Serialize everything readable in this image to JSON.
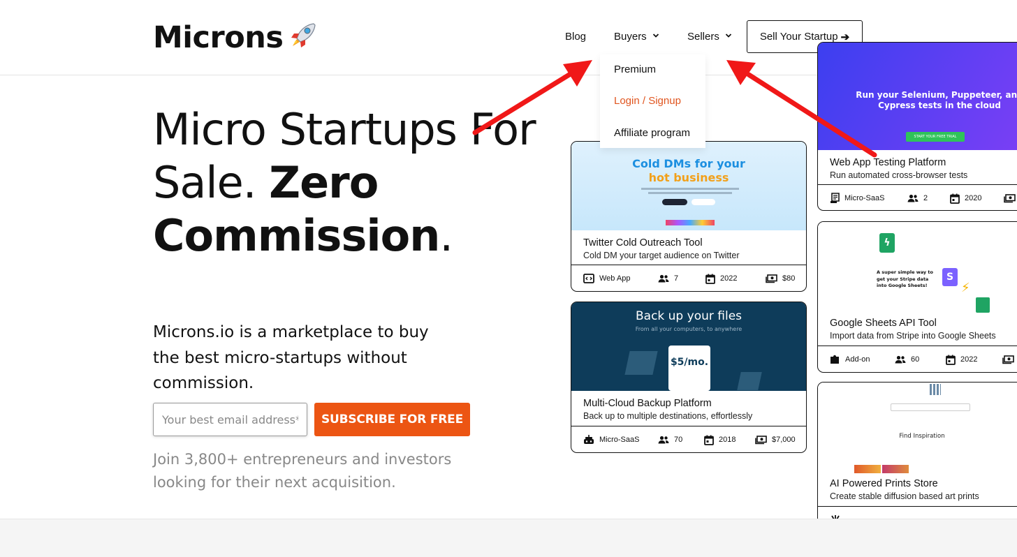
{
  "header": {
    "logo": "Microns",
    "nav": {
      "blog": "Blog",
      "buyers": "Buyers",
      "sellers": "Sellers"
    },
    "cta": "Sell Your Startup"
  },
  "dropdown": {
    "items": [
      "Premium",
      "Login / Signup",
      "Affiliate program"
    ]
  },
  "hero": {
    "title_light": "Micro Startups For Sale.",
    "title_bold_1": "Zero",
    "title_bold_2": "Commission",
    "title_tail": ".",
    "description": "Microns.io is a marketplace to buy the best micro-startups without commission.",
    "email_placeholder": "Your best email address*",
    "subscribe_label": "SUBSCRIBE FOR FREE",
    "join_text": "Join 3,800+ entrepreneurs and investors looking for their next acquisition."
  },
  "listings": [
    {
      "id": "twitter",
      "image_headline_1": "Cold DMs for your",
      "image_headline_2": "hot business",
      "title": "Twitter Cold Outreach Tool",
      "subtitle": "Cold DM your target audience on Twitter",
      "category": "Web App",
      "customers": "7",
      "year": "2022",
      "price": "$80"
    },
    {
      "id": "backup",
      "image_headline": "Back up your files",
      "image_sub": "From all your computers, to anywhere",
      "image_price": "$5/mo.",
      "title": "Multi-Cloud Backup Platform",
      "subtitle": "Back up to multiple destinations, effortlessly",
      "category": "Micro-SaaS",
      "customers": "70",
      "year": "2018",
      "price": "$7,000"
    },
    {
      "id": "webapp",
      "image_headline": "Run your Selenium, Puppeteer, and Cypress tests in the cloud",
      "image_button": "START YOUR FREE TRIAL",
      "title": "Web App Testing Platform",
      "subtitle": "Run automated cross-browser tests",
      "category": "Micro-SaaS",
      "customers": "2",
      "year": "2020"
    },
    {
      "id": "sheets",
      "image_text": "A super simple way to get your Stripe data into Google Sheets!",
      "title": "Google Sheets API Tool",
      "subtitle": "Import data from Stripe into Google Sheets",
      "category": "Add-on",
      "customers": "60",
      "year": "2022"
    },
    {
      "id": "prints",
      "image_heading": "Find Inspiration",
      "title": "AI Powered Prints Store",
      "subtitle": "Create stable diffusion based art prints"
    }
  ],
  "colors": {
    "accent": "#ec5513",
    "login_link": "#e0551f",
    "annotation_arrow": "#f01818"
  }
}
